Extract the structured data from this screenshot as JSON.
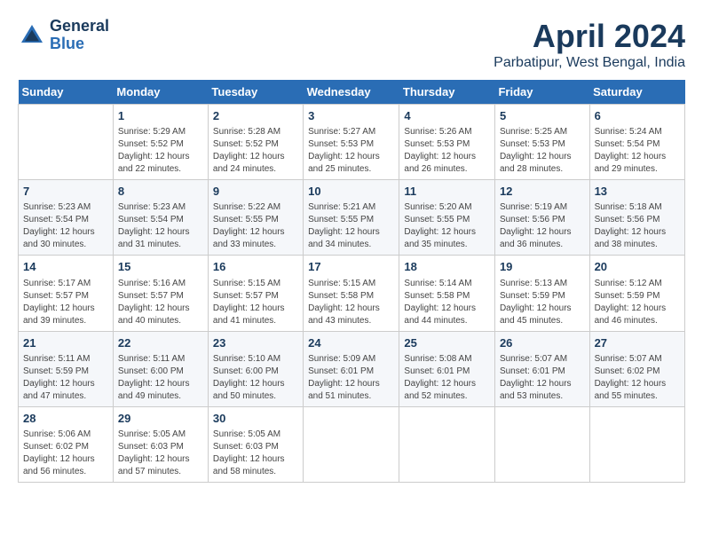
{
  "header": {
    "logo_line1": "General",
    "logo_line2": "Blue",
    "title": "April 2024",
    "subtitle": "Parbatipur, West Bengal, India"
  },
  "calendar": {
    "days_of_week": [
      "Sunday",
      "Monday",
      "Tuesday",
      "Wednesday",
      "Thursday",
      "Friday",
      "Saturday"
    ],
    "weeks": [
      [
        {
          "day": "",
          "info": ""
        },
        {
          "day": "1",
          "info": "Sunrise: 5:29 AM\nSunset: 5:52 PM\nDaylight: 12 hours\nand 22 minutes."
        },
        {
          "day": "2",
          "info": "Sunrise: 5:28 AM\nSunset: 5:52 PM\nDaylight: 12 hours\nand 24 minutes."
        },
        {
          "day": "3",
          "info": "Sunrise: 5:27 AM\nSunset: 5:53 PM\nDaylight: 12 hours\nand 25 minutes."
        },
        {
          "day": "4",
          "info": "Sunrise: 5:26 AM\nSunset: 5:53 PM\nDaylight: 12 hours\nand 26 minutes."
        },
        {
          "day": "5",
          "info": "Sunrise: 5:25 AM\nSunset: 5:53 PM\nDaylight: 12 hours\nand 28 minutes."
        },
        {
          "day": "6",
          "info": "Sunrise: 5:24 AM\nSunset: 5:54 PM\nDaylight: 12 hours\nand 29 minutes."
        }
      ],
      [
        {
          "day": "7",
          "info": "Sunrise: 5:23 AM\nSunset: 5:54 PM\nDaylight: 12 hours\nand 30 minutes."
        },
        {
          "day": "8",
          "info": "Sunrise: 5:23 AM\nSunset: 5:54 PM\nDaylight: 12 hours\nand 31 minutes."
        },
        {
          "day": "9",
          "info": "Sunrise: 5:22 AM\nSunset: 5:55 PM\nDaylight: 12 hours\nand 33 minutes."
        },
        {
          "day": "10",
          "info": "Sunrise: 5:21 AM\nSunset: 5:55 PM\nDaylight: 12 hours\nand 34 minutes."
        },
        {
          "day": "11",
          "info": "Sunrise: 5:20 AM\nSunset: 5:55 PM\nDaylight: 12 hours\nand 35 minutes."
        },
        {
          "day": "12",
          "info": "Sunrise: 5:19 AM\nSunset: 5:56 PM\nDaylight: 12 hours\nand 36 minutes."
        },
        {
          "day": "13",
          "info": "Sunrise: 5:18 AM\nSunset: 5:56 PM\nDaylight: 12 hours\nand 38 minutes."
        }
      ],
      [
        {
          "day": "14",
          "info": "Sunrise: 5:17 AM\nSunset: 5:57 PM\nDaylight: 12 hours\nand 39 minutes."
        },
        {
          "day": "15",
          "info": "Sunrise: 5:16 AM\nSunset: 5:57 PM\nDaylight: 12 hours\nand 40 minutes."
        },
        {
          "day": "16",
          "info": "Sunrise: 5:15 AM\nSunset: 5:57 PM\nDaylight: 12 hours\nand 41 minutes."
        },
        {
          "day": "17",
          "info": "Sunrise: 5:15 AM\nSunset: 5:58 PM\nDaylight: 12 hours\nand 43 minutes."
        },
        {
          "day": "18",
          "info": "Sunrise: 5:14 AM\nSunset: 5:58 PM\nDaylight: 12 hours\nand 44 minutes."
        },
        {
          "day": "19",
          "info": "Sunrise: 5:13 AM\nSunset: 5:59 PM\nDaylight: 12 hours\nand 45 minutes."
        },
        {
          "day": "20",
          "info": "Sunrise: 5:12 AM\nSunset: 5:59 PM\nDaylight: 12 hours\nand 46 minutes."
        }
      ],
      [
        {
          "day": "21",
          "info": "Sunrise: 5:11 AM\nSunset: 5:59 PM\nDaylight: 12 hours\nand 47 minutes."
        },
        {
          "day": "22",
          "info": "Sunrise: 5:11 AM\nSunset: 6:00 PM\nDaylight: 12 hours\nand 49 minutes."
        },
        {
          "day": "23",
          "info": "Sunrise: 5:10 AM\nSunset: 6:00 PM\nDaylight: 12 hours\nand 50 minutes."
        },
        {
          "day": "24",
          "info": "Sunrise: 5:09 AM\nSunset: 6:01 PM\nDaylight: 12 hours\nand 51 minutes."
        },
        {
          "day": "25",
          "info": "Sunrise: 5:08 AM\nSunset: 6:01 PM\nDaylight: 12 hours\nand 52 minutes."
        },
        {
          "day": "26",
          "info": "Sunrise: 5:07 AM\nSunset: 6:01 PM\nDaylight: 12 hours\nand 53 minutes."
        },
        {
          "day": "27",
          "info": "Sunrise: 5:07 AM\nSunset: 6:02 PM\nDaylight: 12 hours\nand 55 minutes."
        }
      ],
      [
        {
          "day": "28",
          "info": "Sunrise: 5:06 AM\nSunset: 6:02 PM\nDaylight: 12 hours\nand 56 minutes."
        },
        {
          "day": "29",
          "info": "Sunrise: 5:05 AM\nSunset: 6:03 PM\nDaylight: 12 hours\nand 57 minutes."
        },
        {
          "day": "30",
          "info": "Sunrise: 5:05 AM\nSunset: 6:03 PM\nDaylight: 12 hours\nand 58 minutes."
        },
        {
          "day": "",
          "info": ""
        },
        {
          "day": "",
          "info": ""
        },
        {
          "day": "",
          "info": ""
        },
        {
          "day": "",
          "info": ""
        }
      ]
    ]
  }
}
